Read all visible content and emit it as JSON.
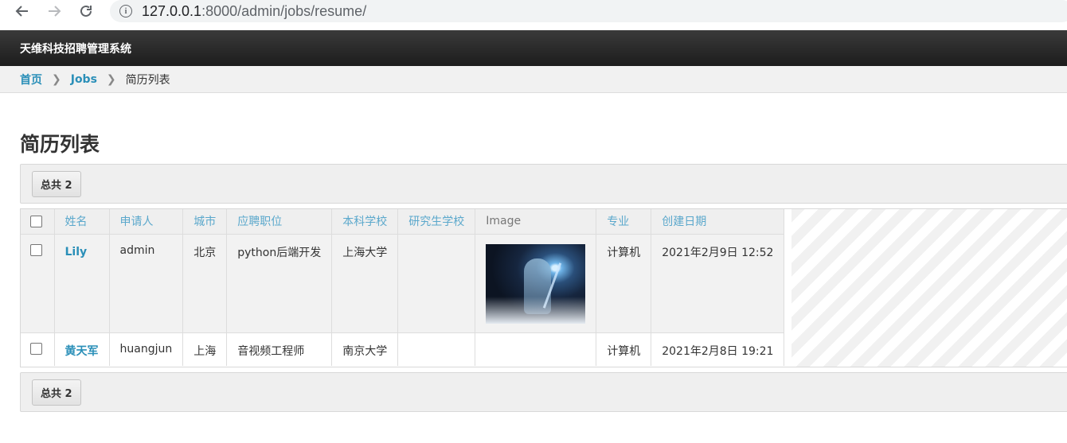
{
  "browser": {
    "url_host": "127.0.0.1",
    "url_path": ":8000/admin/jobs/resume/"
  },
  "header": {
    "site_title": "天维科技招聘管理系统"
  },
  "breadcrumbs": {
    "home": "首页",
    "app": "Jobs",
    "current": "简历列表"
  },
  "page_title": "简历列表",
  "actions": {
    "count_label": "总共 2"
  },
  "table": {
    "columns": [
      "姓名",
      "申请人",
      "城市",
      "应聘职位",
      "本科学校",
      "研究生学校",
      "Image",
      "专业",
      "创建日期"
    ],
    "rows": [
      {
        "name": "Lily",
        "applicant": "admin",
        "city": "北京",
        "position": "python后端开发",
        "bachelor_school": "上海大学",
        "master_school": "",
        "has_image": true,
        "major": "计算机",
        "created": "2021年2月9日 12:52"
      },
      {
        "name": "黄天军",
        "applicant": "huangjun",
        "city": "上海",
        "position": "音视频工程师",
        "bachelor_school": "南京大学",
        "master_school": "",
        "has_image": false,
        "major": "计算机",
        "created": "2021年2月8日 19:21"
      }
    ]
  },
  "colors": {
    "header_bg": "#1c1c1c",
    "link": "#2a8fb8",
    "header_link": "#5ba8cc"
  }
}
